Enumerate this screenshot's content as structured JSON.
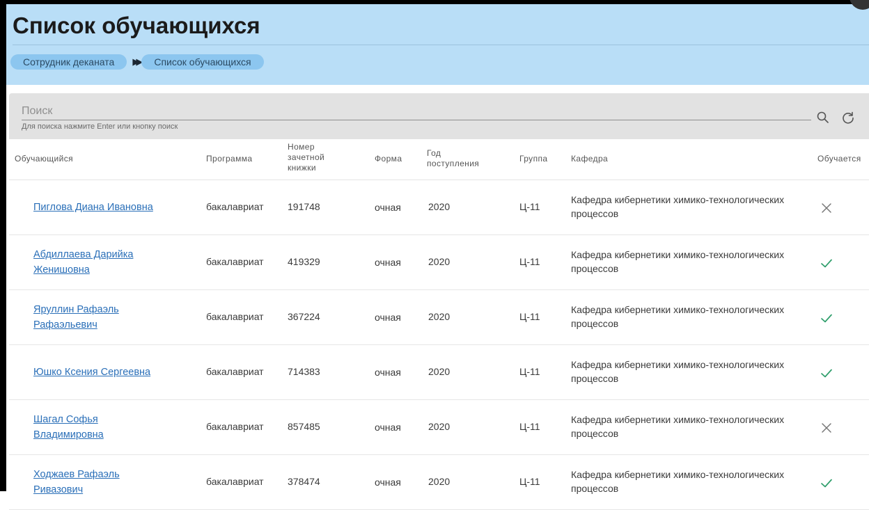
{
  "header": {
    "title": "Список обучающихся",
    "breadcrumbs": [
      "Сотрудник деканата",
      "Список обучающихся"
    ]
  },
  "search": {
    "placeholder": "Поиск",
    "hint": "Для поиска нажмите Enter или кнопку поиск",
    "search_icon": "search-icon",
    "refresh_icon": "refresh-icon"
  },
  "table": {
    "columns": [
      "Обучающийся",
      "Программа",
      "Номер зачетной книжки",
      "Форма",
      "Год поступления",
      "Группа",
      "Кафедра",
      "Обучается"
    ],
    "rows": [
      {
        "name": "Пиглова Диана Ивановна",
        "program": "бакалавриат",
        "record_book": "191748",
        "form": "очная",
        "year": "2020",
        "group": "Ц-11",
        "department": "Кафедра кибернетики химико-технологических процессов",
        "studying": false
      },
      {
        "name": "Абдиллаева Дарийка Женишовна",
        "program": "бакалавриат",
        "record_book": "419329",
        "form": "очная",
        "year": "2020",
        "group": "Ц-11",
        "department": "Кафедра кибернетики химико-технологических процессов",
        "studying": true
      },
      {
        "name": "Яруллин Рафаэль Рафаэльевич",
        "program": "бакалавриат",
        "record_book": "367224",
        "form": "очная",
        "year": "2020",
        "group": "Ц-11",
        "department": "Кафедра кибернетики химико-технологических процессов",
        "studying": true
      },
      {
        "name": "Юшко Ксения Сергеевна",
        "program": "бакалавриат",
        "record_book": "714383",
        "form": "очная",
        "year": "2020",
        "group": "Ц-11",
        "department": "Кафедра кибернетики химико-технологических процессов",
        "studying": true
      },
      {
        "name": "Шагал Софья Владимировна",
        "program": "бакалавриат",
        "record_book": "857485",
        "form": "очная",
        "year": "2020",
        "group": "Ц-11",
        "department": "Кафедра кибернетики химико-технологических процессов",
        "studying": false
      },
      {
        "name": "Ходжаев Рафаэль Ривазович",
        "program": "бакалавриат",
        "record_book": "378474",
        "form": "очная",
        "year": "2020",
        "group": "Ц-11",
        "department": "Кафедра кибернетики химико-технологических процессов",
        "studying": true
      }
    ]
  },
  "colors": {
    "header_bg": "#b9def7",
    "breadcrumb_bg": "#8cc6ef",
    "link": "#2a6fb8",
    "check": "#2e9e6b",
    "cross": "#777777"
  }
}
